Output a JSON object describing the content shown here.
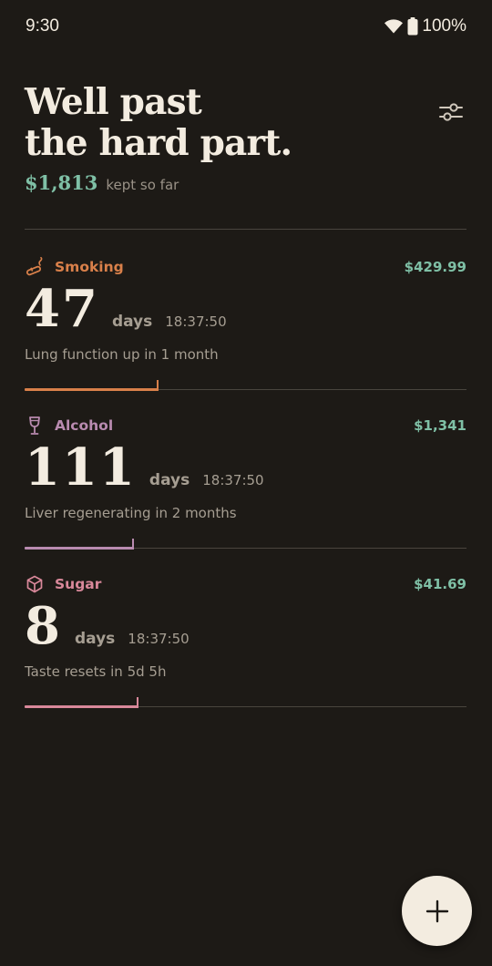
{
  "status_bar": {
    "time": "9:30",
    "battery": "100%"
  },
  "header": {
    "headline_line1": "Well past",
    "headline_line2": "the hard part.",
    "saved_amount": "$1,813",
    "saved_caption": "kept so far"
  },
  "habits": [
    {
      "name": "Smoking",
      "icon": "cigarette-icon",
      "money": "$429.99",
      "days": "47",
      "days_unit": "days",
      "clock": "18:37:50",
      "milestone": "Lung function up in 1 month",
      "color": "#d9804a",
      "progress": 0.3
    },
    {
      "name": "Alcohol",
      "icon": "wine-glass-icon",
      "money": "$1,341",
      "days": "111",
      "days_unit": "days",
      "clock": "18:37:50",
      "milestone": "Liver regenerating in 2 months",
      "color": "#b98bb0",
      "progress": 0.245
    },
    {
      "name": "Sugar",
      "icon": "sugar-cube-icon",
      "money": "$41.69",
      "days": "8",
      "days_unit": "days",
      "clock": "18:37:50",
      "milestone": "Taste resets in 5d 5h",
      "color": "#d9889a",
      "progress": 0.255
    }
  ],
  "colors": {
    "background": "#1d1a16",
    "accent_green": "#7fc0a6",
    "text": "#f3ece0",
    "muted": "#a69e92"
  }
}
